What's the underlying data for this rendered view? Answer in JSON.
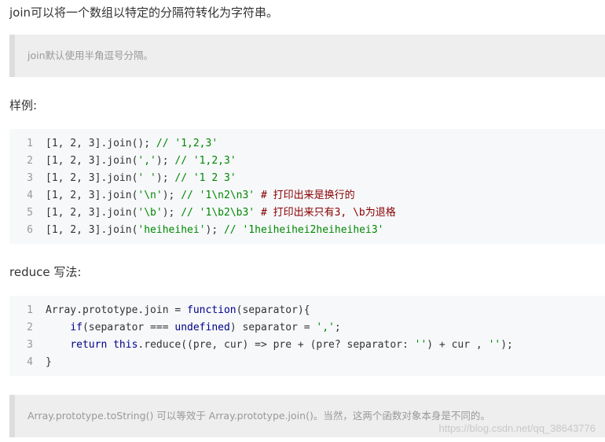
{
  "intro_text": "join可以将一个数组以特定的分隔符转化为字符串。",
  "note_1": "join默认使用半角逗号分隔。",
  "example_heading": "样例:",
  "code_block_1": {
    "line_numbers": [
      "1",
      "2",
      "3",
      "4",
      "5",
      "6"
    ],
    "lines": [
      [
        [
          "plain",
          "[1, 2, 3].join(); "
        ],
        [
          "cmt",
          "// '1,2,3'"
        ]
      ],
      [
        [
          "plain",
          "[1, 2, 3].join("
        ],
        [
          "str",
          "','"
        ],
        [
          "plain",
          "); "
        ],
        [
          "cmt",
          "// '1,2,3'"
        ]
      ],
      [
        [
          "plain",
          "[1, 2, 3].join("
        ],
        [
          "str",
          "' '"
        ],
        [
          "plain",
          "); "
        ],
        [
          "cmt",
          "// '1 2 3'"
        ]
      ],
      [
        [
          "plain",
          "[1, 2, 3].join("
        ],
        [
          "str",
          "'\\n'"
        ],
        [
          "plain",
          "); "
        ],
        [
          "cmt",
          "// '1\\n2\\n3'"
        ],
        [
          "zh",
          " # 打印出来是换行的"
        ]
      ],
      [
        [
          "plain",
          "[1, 2, 3].join("
        ],
        [
          "str",
          "'\\b'"
        ],
        [
          "plain",
          "); "
        ],
        [
          "cmt",
          "// '1\\b2\\b3'"
        ],
        [
          "zh",
          " # 打印出来只有3, \\b为退格"
        ]
      ],
      [
        [
          "plain",
          "[1, 2, 3].join("
        ],
        [
          "str",
          "'heiheihei'"
        ],
        [
          "plain",
          "); "
        ],
        [
          "cmt",
          "// '1heiheihei2heiheihei3'"
        ]
      ]
    ]
  },
  "reduce_heading": "reduce 写法:",
  "code_block_2": {
    "line_numbers": [
      "1",
      "2",
      "3",
      "4"
    ],
    "lines": [
      [
        [
          "plain",
          "Array.prototype.join = "
        ],
        [
          "kw",
          "function"
        ],
        [
          "plain",
          "(separator){"
        ]
      ],
      [
        [
          "plain",
          "    "
        ],
        [
          "kw",
          "if"
        ],
        [
          "plain",
          "(separator === "
        ],
        [
          "kw",
          "undefined"
        ],
        [
          "plain",
          ") separator = "
        ],
        [
          "str",
          "','"
        ],
        [
          "plain",
          ";"
        ]
      ],
      [
        [
          "plain",
          "    "
        ],
        [
          "kw",
          "return"
        ],
        [
          "plain",
          " "
        ],
        [
          "kw",
          "this"
        ],
        [
          "plain",
          ".reduce((pre, cur) => pre + (pre? separator: "
        ],
        [
          "str",
          "''"
        ],
        [
          "plain",
          ") + cur , "
        ],
        [
          "str",
          "''"
        ],
        [
          "plain",
          ");"
        ]
      ],
      [
        [
          "plain",
          "}"
        ]
      ]
    ]
  },
  "note_2": "Array.prototype.toString() 可以等效于 Array.prototype.join()。当然，这两个函数对象本身是不同的。",
  "watermark": "https://blog.csdn.net/qq_38643776"
}
